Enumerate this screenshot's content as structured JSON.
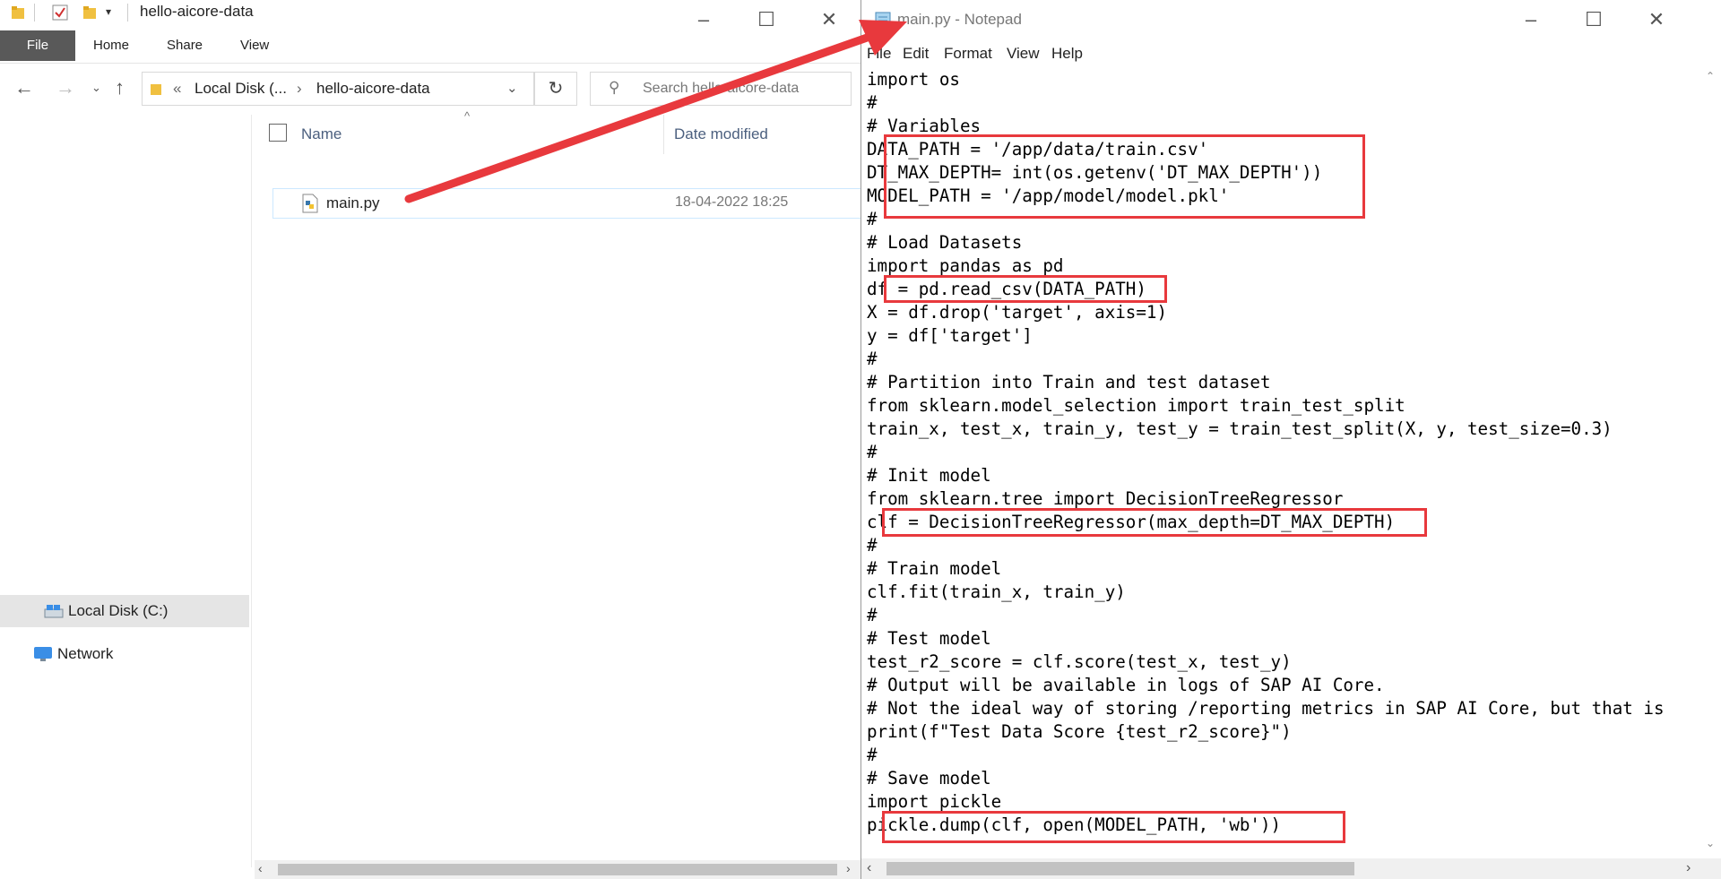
{
  "explorer": {
    "title": "hello-aicore-data",
    "ribbon_tabs": [
      "File",
      "Home",
      "Share",
      "View"
    ],
    "breadcrumb": {
      "overflow": "«",
      "items": [
        "Local Disk (...",
        "hello-aicore-data"
      ]
    },
    "search_placeholder": "Search hello-aicore-data",
    "columns": {
      "name": "Name",
      "date": "Date modified"
    },
    "files": [
      {
        "name": "main.py",
        "date": "18-04-2022 18:25"
      }
    ],
    "nav_items": [
      {
        "label": "Local Disk (C:)",
        "selected": true
      },
      {
        "label": "Network",
        "selected": false
      }
    ]
  },
  "notepad": {
    "title": "main.py - Notepad",
    "menu": [
      "File",
      "Edit",
      "Format",
      "View",
      "Help"
    ],
    "code": [
      "import os",
      "#",
      "# Variables",
      "DATA_PATH = '/app/data/train.csv'",
      "DT_MAX_DEPTH= int(os.getenv('DT_MAX_DEPTH'))",
      "MODEL_PATH = '/app/model/model.pkl'",
      "#",
      "# Load Datasets",
      "import pandas as pd",
      "df = pd.read_csv(DATA_PATH)",
      "X = df.drop('target', axis=1)",
      "y = df['target']",
      "#",
      "# Partition into Train and test dataset",
      "from sklearn.model_selection import train_test_split",
      "train_x, test_x, train_y, test_y = train_test_split(X, y, test_size=0.3)",
      "#",
      "# Init model",
      "from sklearn.tree import DecisionTreeRegressor",
      "clf = DecisionTreeRegressor(max_depth=DT_MAX_DEPTH)",
      "#",
      "# Train model",
      "clf.fit(train_x, train_y)",
      "#",
      "# Test model",
      "test_r2_score = clf.score(test_x, test_y)",
      "# Output will be available in logs of SAP AI Core.",
      "# Not the ideal way of storing /reporting metrics in SAP AI Core, but that is",
      "print(f\"Test Data Score {test_r2_score}\")",
      "#",
      "# Save model",
      "import pickle",
      "pickle.dump(clf, open(MODEL_PATH, 'wb'))"
    ]
  },
  "colors": {
    "highlight": "#e8393d",
    "arrow": "#e8393d",
    "file_tab": "#595959",
    "selection": "#cce8ff"
  }
}
